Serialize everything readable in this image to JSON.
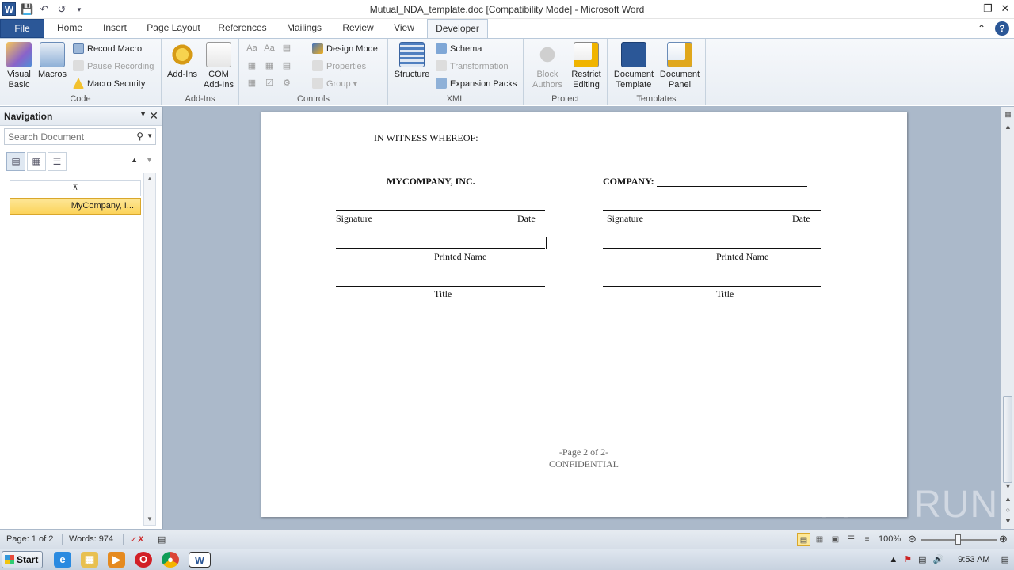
{
  "window": {
    "title": "Mutual_NDA_template.doc [Compatibility Mode]  -  Microsoft Word",
    "app_icon": "W",
    "controls": [
      "minimize-icon",
      "restore-icon",
      "close-icon"
    ]
  },
  "qat": {
    "icons": [
      "save-icon",
      "undo-icon",
      "redo-icon",
      "customize-qat-icon"
    ]
  },
  "tabs": [
    {
      "label": "File"
    },
    {
      "label": "Home"
    },
    {
      "label": "Insert"
    },
    {
      "label": "Page Layout"
    },
    {
      "label": "References"
    },
    {
      "label": "Mailings"
    },
    {
      "label": "Review"
    },
    {
      "label": "View"
    },
    {
      "label": "Developer"
    }
  ],
  "ribbon": {
    "code": {
      "label": "Code",
      "visual_basic": "Visual\nBasic",
      "macros": "Macros",
      "record_macro": "Record Macro",
      "pause_recording": "Pause Recording",
      "macro_security": "Macro Security"
    },
    "addins": {
      "label": "Add-Ins",
      "addins": "Add-Ins",
      "com_addins": "COM\nAdd-Ins"
    },
    "controls": {
      "label": "Controls",
      "design_mode": "Design Mode",
      "properties": "Properties",
      "group": "Group"
    },
    "xml": {
      "label": "XML",
      "structure": "Structure",
      "schema": "Schema",
      "transformation": "Transformation",
      "expansion_packs": "Expansion Packs"
    },
    "protect": {
      "label": "Protect",
      "block_authors": "Block\nAuthors",
      "restrict_editing": "Restrict\nEditing"
    },
    "templates": {
      "label": "Templates",
      "document_template": "Document\nTemplate",
      "document_panel": "Document\nPanel"
    }
  },
  "nav": {
    "title": "Navigation",
    "search_placeholder": "Search Document",
    "items": [
      {
        "label": "MyCompany, I..."
      }
    ]
  },
  "document": {
    "witness": "IN WITNESS  WHEREOF:",
    "left_company": "MYCOMPANY,  INC.",
    "right_company": "COMPANY:",
    "signature": "Signature",
    "date": "Date",
    "printed_name": "Printed Name",
    "title": "Title",
    "page_footer": "-Page 2 of 2-",
    "confidential": "CONFIDENTIAL"
  },
  "status": {
    "page": "Page: 1 of 2",
    "words": "Words: 974",
    "zoom": "100%"
  },
  "watermark": "ANY RUN",
  "taskbar": {
    "start": "Start",
    "clock": "9:53 AM"
  }
}
